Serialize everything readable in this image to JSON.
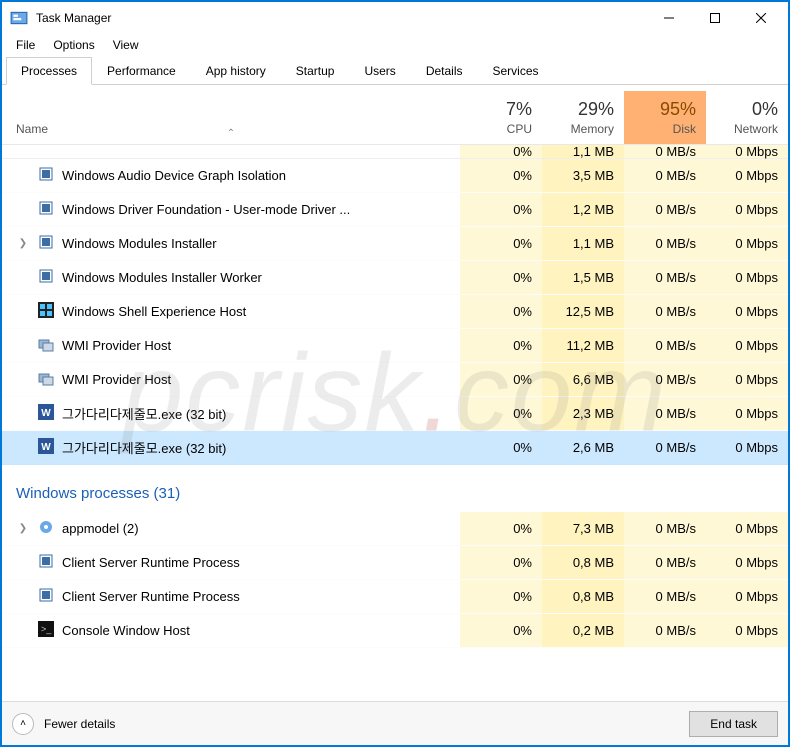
{
  "title": "Task Manager",
  "menu": {
    "file": "File",
    "options": "Options",
    "view": "View"
  },
  "tabs": {
    "processes": "Processes",
    "performance": "Performance",
    "app_history": "App history",
    "startup": "Startup",
    "users": "Users",
    "details": "Details",
    "services": "Services"
  },
  "columns": {
    "name": "Name",
    "cpu": {
      "pct": "7%",
      "label": "CPU"
    },
    "memory": {
      "pct": "29%",
      "label": "Memory"
    },
    "disk": {
      "pct": "95%",
      "label": "Disk"
    },
    "network": {
      "pct": "0%",
      "label": "Network"
    }
  },
  "cutoff": {
    "cpu": "0%",
    "mem": "1,1 MB",
    "disk": "0 MB/s",
    "net": "0 Mbps"
  },
  "procs": [
    {
      "icon": "app",
      "name": "Windows Audio Device Graph Isolation",
      "cpu": "0%",
      "mem": "3,5 MB",
      "disk": "0 MB/s",
      "net": "0 Mbps"
    },
    {
      "icon": "app",
      "name": "Windows Driver Foundation - User-mode Driver ...",
      "cpu": "0%",
      "mem": "1,2 MB",
      "disk": "0 MB/s",
      "net": "0 Mbps"
    },
    {
      "icon": "app",
      "name": "Windows Modules Installer",
      "cpu": "0%",
      "mem": "1,1 MB",
      "disk": "0 MB/s",
      "net": "0 Mbps",
      "expandable": true
    },
    {
      "icon": "app",
      "name": "Windows Modules Installer Worker",
      "cpu": "0%",
      "mem": "1,5 MB",
      "disk": "0 MB/s",
      "net": "0 Mbps"
    },
    {
      "icon": "shell",
      "name": "Windows Shell Experience Host",
      "cpu": "0%",
      "mem": "12,5 MB",
      "disk": "0 MB/s",
      "net": "0 Mbps"
    },
    {
      "icon": "wmi",
      "name": "WMI Provider Host",
      "cpu": "0%",
      "mem": "11,2 MB",
      "disk": "0 MB/s",
      "net": "0 Mbps"
    },
    {
      "icon": "wmi",
      "name": "WMI Provider Host",
      "cpu": "0%",
      "mem": "6,6 MB",
      "disk": "0 MB/s",
      "net": "0 Mbps"
    },
    {
      "icon": "word",
      "name": "그가다리다제줄모.exe (32 bit)",
      "cpu": "0%",
      "mem": "2,3 MB",
      "disk": "0 MB/s",
      "net": "0 Mbps"
    },
    {
      "icon": "word",
      "name": "그가다리다제줄모.exe (32 bit)",
      "cpu": "0%",
      "mem": "2,6 MB",
      "disk": "0 MB/s",
      "net": "0 Mbps",
      "selected": true
    }
  ],
  "group": {
    "title": "Windows processes (31)"
  },
  "winprocs": [
    {
      "icon": "gear",
      "name": "appmodel (2)",
      "cpu": "0%",
      "mem": "7,3 MB",
      "disk": "0 MB/s",
      "net": "0 Mbps",
      "expandable": true
    },
    {
      "icon": "app",
      "name": "Client Server Runtime Process",
      "cpu": "0%",
      "mem": "0,8 MB",
      "disk": "0 MB/s",
      "net": "0 Mbps"
    },
    {
      "icon": "app",
      "name": "Client Server Runtime Process",
      "cpu": "0%",
      "mem": "0,8 MB",
      "disk": "0 MB/s",
      "net": "0 Mbps"
    },
    {
      "icon": "console",
      "name": "Console Window Host",
      "cpu": "0%",
      "mem": "0,2 MB",
      "disk": "0 MB/s",
      "net": "0 Mbps"
    }
  ],
  "footer": {
    "fewer": "Fewer details",
    "end_task": "End task"
  },
  "watermark": {
    "a": "pcrisk",
    "b": ".",
    "c": "com"
  }
}
